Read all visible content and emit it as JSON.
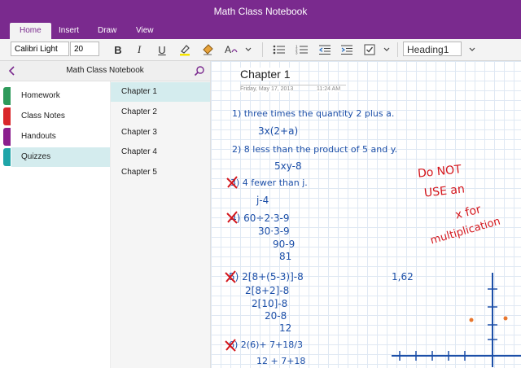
{
  "window": {
    "title": "Math Class Notebook"
  },
  "tabs": [
    {
      "label": "Home"
    },
    {
      "label": "Insert"
    },
    {
      "label": "Draw"
    },
    {
      "label": "View"
    }
  ],
  "ribbon": {
    "font_name": "Calibri Light",
    "font_size": "20",
    "bold": "B",
    "italic": "I",
    "underline": "U",
    "style": "Heading1"
  },
  "nav": {
    "notebook_name": "Math Class Notebook",
    "sections": [
      {
        "label": "Homework",
        "color": "#2e9a5b"
      },
      {
        "label": "Class Notes",
        "color": "#d9262b"
      },
      {
        "label": "Handouts",
        "color": "#8b1f8e"
      },
      {
        "label": "Quizzes",
        "color": "#1fa5a8"
      }
    ],
    "pages": [
      {
        "label": "Chapter 1"
      },
      {
        "label": "Chapter 2"
      },
      {
        "label": "Chapter 3"
      },
      {
        "label": "Chapter 4"
      },
      {
        "label": "Chapter 5"
      }
    ]
  },
  "page": {
    "title": "Chapter 1",
    "date": "Friday, May 17, 2013",
    "time": "11:24 AM",
    "ink": {
      "l1": "1) three times the quantity 2 plus a.",
      "l2": "3x(2+a)",
      "l3": "2) 8 less than the product of 5 and y.",
      "l4": "5xy-8",
      "l5": "3) 4 fewer than j.",
      "l6": "j-4",
      "l7": "4) 60÷2·3-9",
      "l8": "30·3-9",
      "l9": "90-9",
      "l10": "81",
      "l11": "5) 2[8+(5-3)]-8",
      "l12": "2[8+2]-8",
      "l13": "2[10]-8",
      "l14": "20-8",
      "l15": "12",
      "l16": "1,62",
      "l17": "6) 2(6)+ 7+18/3",
      "l18": "12 + 7+18",
      "n1": "Do NOT",
      "n2": "USE an",
      "n3": "x for",
      "n4": "multiplication"
    }
  },
  "colors": {
    "accent": "#7a2a8e",
    "selected": "#d4ecee",
    "ink_blue": "#1c4fa8",
    "ink_red": "#d4161c"
  }
}
